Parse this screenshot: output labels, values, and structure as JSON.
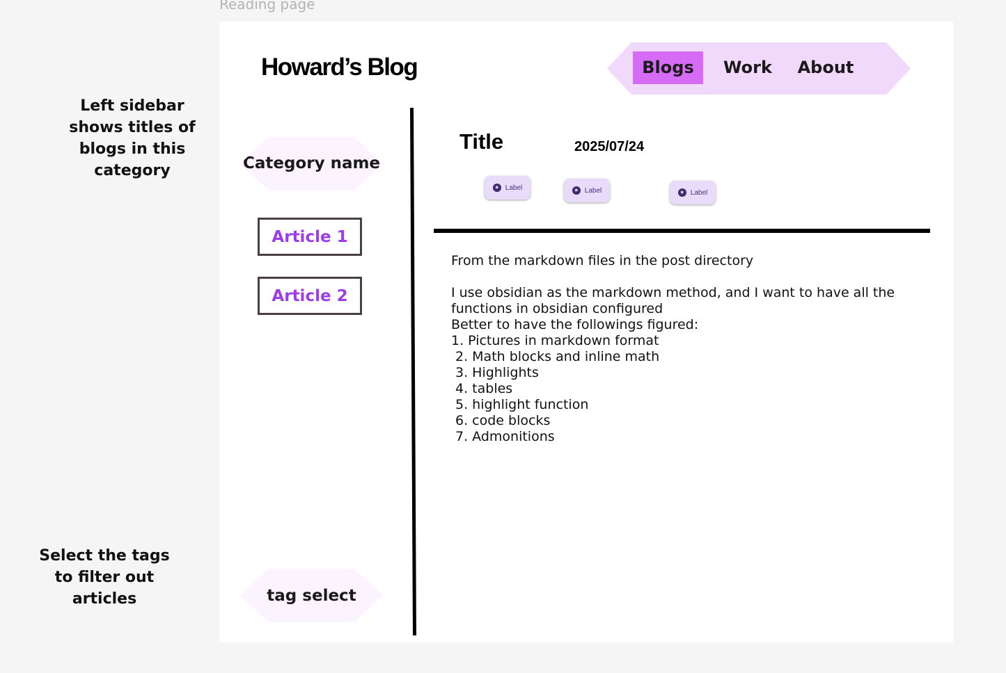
{
  "frame_label": "Reading page",
  "annotations": {
    "sidebar_note": "Left sidebar shows titles of blogs in this category",
    "tags_note": "Select the tags to filter out articles"
  },
  "header": {
    "site_title": "Howard’s Blog",
    "nav": [
      {
        "label": "Blogs",
        "active": true
      },
      {
        "label": "Work",
        "active": false
      },
      {
        "label": "About",
        "active": false
      }
    ]
  },
  "sidebar": {
    "category_name": "Category name",
    "articles": [
      {
        "label": "Article 1"
      },
      {
        "label": "Article 2"
      }
    ],
    "tag_select": "tag select"
  },
  "post": {
    "title": "Title",
    "date": "2025/07/24",
    "labels": [
      "Label",
      "Label",
      "Label"
    ],
    "intro": "From the markdown files in the post directory",
    "paragraph": "I use obsidian as the markdown method, and I want to have all the functions in obsidian configured",
    "list_heading": "Better to have the followings figured:",
    "list": [
      "1. Pictures in markdown format",
      "2. Math blocks and inline math",
      "3. Highlights",
      "4. tables",
      "5. highlight function",
      "6. code blocks",
      "7. Admonitions"
    ]
  },
  "colors": {
    "nav_background": "#f1d9fb",
    "nav_active": "#d66cf6",
    "article_link": "#9b3ee8",
    "chip_background": "#e9dcfb"
  }
}
